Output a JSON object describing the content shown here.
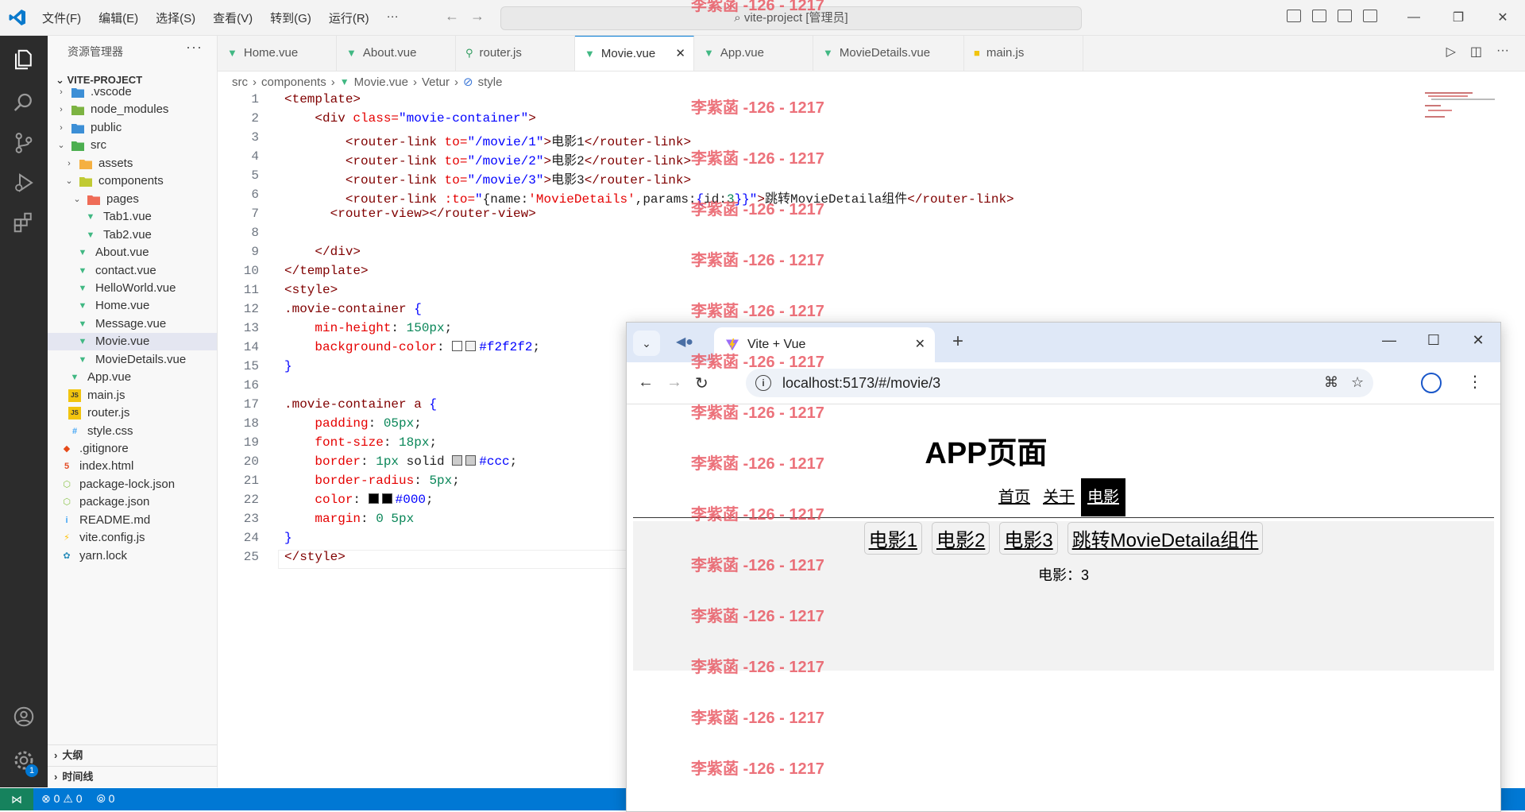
{
  "titlebar": {
    "menu": [
      "文件(F)",
      "编辑(E)",
      "选择(S)",
      "查看(V)",
      "转到(G)",
      "运行(R)",
      "···"
    ],
    "search": "vite-project [管理员]"
  },
  "sidebar": {
    "header": "资源管理器",
    "more": "···",
    "project": "VITE-PROJECT",
    "items": [
      {
        "label": ".vscode",
        "icon": "vscode-folder-icon",
        "color": "#3c8fd6"
      },
      {
        "label": "node_modules",
        "icon": "node-folder-icon",
        "color": "#7cb342"
      },
      {
        "label": "public",
        "icon": "public-folder-icon",
        "color": "#3c8fd6"
      },
      {
        "label": "src",
        "icon": "src-folder-icon",
        "color": "#4caf50"
      },
      {
        "label": "assets",
        "icon": "folder-icon",
        "color": "#f5b041"
      },
      {
        "label": "components",
        "icon": "components-folder-icon",
        "color": "#c0ca33"
      },
      {
        "label": "pages",
        "icon": "pages-folder-icon",
        "color": "#ef6c57"
      },
      {
        "label": "Tab1.vue",
        "icon": "vue-icon",
        "color": "#41b883"
      },
      {
        "label": "Tab2.vue",
        "icon": "vue-icon",
        "color": "#41b883"
      },
      {
        "label": "About.vue",
        "icon": "vue-icon",
        "color": "#41b883"
      },
      {
        "label": "contact.vue",
        "icon": "vue-icon",
        "color": "#41b883"
      },
      {
        "label": "HelloWorld.vue",
        "icon": "vue-icon",
        "color": "#41b883"
      },
      {
        "label": "Home.vue",
        "icon": "vue-icon",
        "color": "#41b883"
      },
      {
        "label": "Message.vue",
        "icon": "vue-icon",
        "color": "#41b883"
      },
      {
        "label": "Movie.vue",
        "icon": "vue-icon",
        "color": "#41b883"
      },
      {
        "label": "MovieDetails.vue",
        "icon": "vue-icon",
        "color": "#41b883"
      },
      {
        "label": "App.vue",
        "icon": "vue-icon",
        "color": "#41b883"
      },
      {
        "label": "main.js",
        "icon": "js-icon",
        "color": "#f1c40f"
      },
      {
        "label": "router.js",
        "icon": "js-icon",
        "color": "#f1c40f"
      },
      {
        "label": "style.css",
        "icon": "css-icon",
        "color": "#42a5f5"
      },
      {
        "label": ".gitignore",
        "icon": "git-icon",
        "color": "#e64a19"
      },
      {
        "label": "index.html",
        "icon": "html-icon",
        "color": "#e44d26"
      },
      {
        "label": "package-lock.json",
        "icon": "npm-icon",
        "color": "#8bc34a"
      },
      {
        "label": "package.json",
        "icon": "npm-icon",
        "color": "#8bc34a"
      },
      {
        "label": "README.md",
        "icon": "info-icon",
        "color": "#42a5f5"
      },
      {
        "label": "vite.config.js",
        "icon": "vite-icon",
        "color": "#ffc107"
      },
      {
        "label": "yarn.lock",
        "icon": "yarn-icon",
        "color": "#2c8ebb"
      }
    ],
    "outline": "大纲",
    "timeline": "时间线"
  },
  "tabs": [
    {
      "label": "Home.vue",
      "icon": "vue-icon"
    },
    {
      "label": "About.vue",
      "icon": "vue-icon"
    },
    {
      "label": "router.js",
      "icon": "router-icon"
    },
    {
      "label": "Movie.vue",
      "icon": "vue-icon"
    },
    {
      "label": "App.vue",
      "icon": "vue-icon"
    },
    {
      "label": "MovieDetails.vue",
      "icon": "vue-icon"
    },
    {
      "label": "main.js",
      "icon": "js-icon"
    }
  ],
  "breadcrumb": [
    "src",
    "components",
    "Movie.vue",
    "Vetur",
    "style"
  ],
  "editor": {
    "line_numbers": [
      "1",
      "2",
      "3",
      "4",
      "5",
      "6",
      "7",
      "8",
      "9",
      "10",
      "11",
      "12",
      "13",
      "14",
      "15",
      "16",
      "17",
      "18",
      "19",
      "20",
      "21",
      "22",
      "23",
      "24",
      "25"
    ],
    "code": {
      "l1_tag": "<template>",
      "l2_open": "<div ",
      "l2_attr": "class=",
      "l2_val": "\"movie-container\"",
      "l2_close": ">",
      "l3_open": "<router-link ",
      "l3_attr": "to=",
      "l3_val": "\"/movie/1\"",
      "l3_gt": ">",
      "l3_text": "电影1",
      "l3_close": "</router-link>",
      "l4_open": "<router-link ",
      "l4_attr": "to=",
      "l4_val": "\"/movie/2\"",
      "l4_gt": ">",
      "l4_text": "电影2",
      "l4_close": "</router-link>",
      "l5_open": "<router-link ",
      "l5_attr": "to=",
      "l5_val": "\"/movie/3\"",
      "l5_gt": ">",
      "l5_text": "电影3",
      "l5_close": "</router-link>",
      "l6_open": "<router-link ",
      "l6_attr": ":to=",
      "l6_q": "\"",
      "l6_b1": "{",
      "l6_k1": "name:",
      "l6_v1": "'MovieDetails'",
      "l6_c": ",",
      "l6_k2": "params:",
      "l6_b2": "{",
      "l6_k3": "id:",
      "l6_v3": "3",
      "l6_b3": "}}",
      "l6_q2": "\"",
      "l6_gt": ">",
      "l6_text": "跳转MovieDetaila组件",
      "l6_close": "</router-link>",
      "l7_tag": "<router-view></router-view>",
      "l9_tag": "</div>",
      "l10_tag": "</template>",
      "l11_tag": "<style>",
      "l12_sel": ".movie-container",
      "l12_brace": " {",
      "l13_prop": "min-height",
      "l13_colon": ": ",
      "l13_val": "150px",
      "l13_semi": ";",
      "l14_prop": "background-color",
      "l14_colon": ": ",
      "l14_val": "#f2f2f2",
      "l14_semi": ";",
      "l15_brace": "}",
      "l17_sel": ".movie-container a",
      "l17_brace": " {",
      "l18_prop": "padding",
      "l18_colon": ": ",
      "l18_val": "05px",
      "l18_semi": ";",
      "l19_prop": "font-size",
      "l19_colon": ": ",
      "l19_val": "18px",
      "l19_semi": ";",
      "l20_prop": "border",
      "l20_colon": ": ",
      "l20_val1": "1px",
      "l20_plain": " solid ",
      "l20_val": "#ccc",
      "l20_semi": ";",
      "l21_prop": "border-radius",
      "l21_colon": ": ",
      "l21_val": "5px",
      "l21_semi": ";",
      "l22_prop": "color",
      "l22_colon": ": ",
      "l22_val": "#000",
      "l22_semi": ";",
      "l23_prop": "margin",
      "l23_colon": ": ",
      "l23_val": "0 5px",
      "l24_brace": "}",
      "l25_tag": "</style>"
    }
  },
  "statusbar": {
    "errors": "0",
    "warnings": "0",
    "ports": "0"
  },
  "watermark": "李紫菡 -126 - 1217",
  "browser": {
    "tab_title": "Vite + Vue",
    "url": "localhost:5173/#/movie/3",
    "page": {
      "title": "APP页面",
      "nav": [
        "首页",
        "关于",
        "电影"
      ],
      "active_nav": "电影",
      "movie_links": [
        "电影1",
        "电影2",
        "电影3",
        "跳转MovieDetaila组件"
      ],
      "movie_info": "电影：3"
    }
  },
  "colors": {
    "accent": "#0078d4",
    "activity_bar": "#2c2c2c",
    "watermark": "#e8505b",
    "movie_container_bg": "#f2f2f2"
  }
}
